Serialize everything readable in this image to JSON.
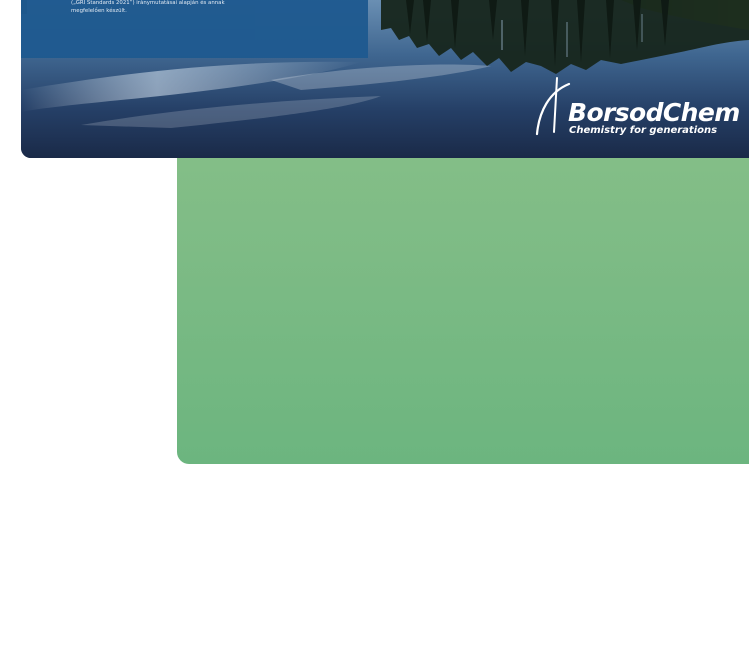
{
  "hero": {
    "text_line_1": "(„GRI Standards 2021”) iránymutatásai alapján és annak",
    "text_line_2": "megfelelően készült.",
    "image_subject": "forest-lake-reflection"
  },
  "logo": {
    "brand": "BorsodChem",
    "tagline": "Chemistry for generations"
  },
  "colors": {
    "text_box": "#1f5a90",
    "green_panel": "#7dbb85",
    "sky_water": "#2f5078"
  }
}
